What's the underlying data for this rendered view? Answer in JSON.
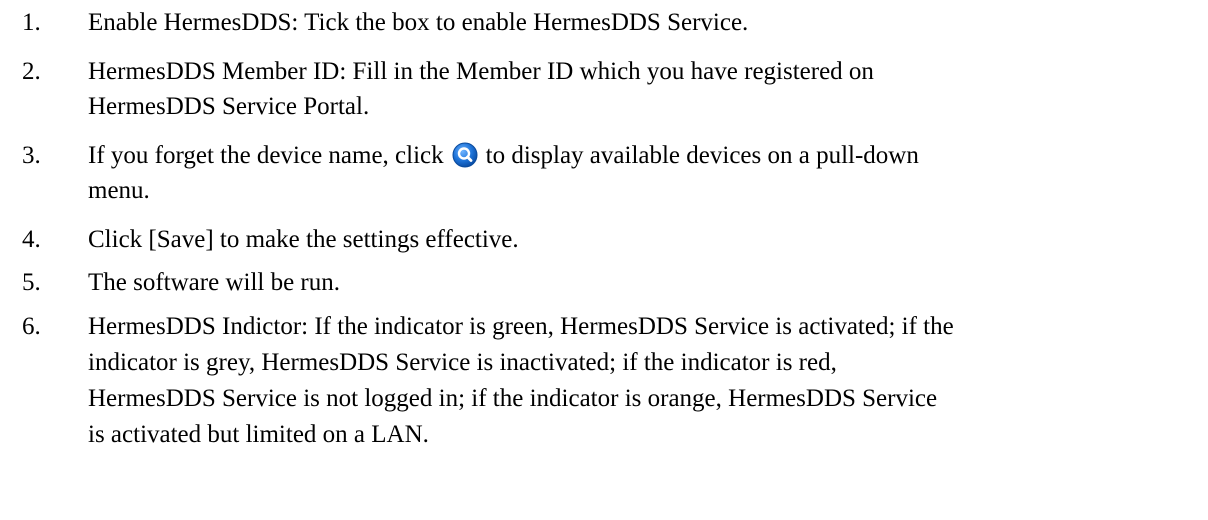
{
  "document": {
    "items": [
      {
        "number": "1.",
        "lines": [
          "Enable HermesDDS: Tick the box to enable HermesDDS Service."
        ]
      },
      {
        "number": "2.",
        "lines": [
          "HermesDDS Member ID: Fill in the Member ID which you have registered on",
          "HermesDDS Service Portal."
        ]
      },
      {
        "number": "3.",
        "line1_before_icon": "If you forget the device name, click",
        "line1_after_icon": "to display available devices on a pull-down",
        "line2": "menu.",
        "icon": "search-icon"
      },
      {
        "number": "4.",
        "lines": [
          "Click [Save] to make the settings effective."
        ]
      },
      {
        "number": "5.",
        "lines": [
          "The software will be run."
        ]
      },
      {
        "number": "6.",
        "lines": [
          "HermesDDS Indictor: If the indicator is green, HermesDDS Service is activated; if the",
          "indicator is grey, HermesDDS Service is inactivated; if the indicator is red,",
          "HermesDDS Service is not logged in; if the indicator is orange, HermesDDS Service",
          "is activated but limited on a LAN."
        ]
      }
    ]
  },
  "colors": {
    "text": "#000000",
    "icon_blue": "#1e73d8",
    "icon_ring": "#ffffff"
  }
}
